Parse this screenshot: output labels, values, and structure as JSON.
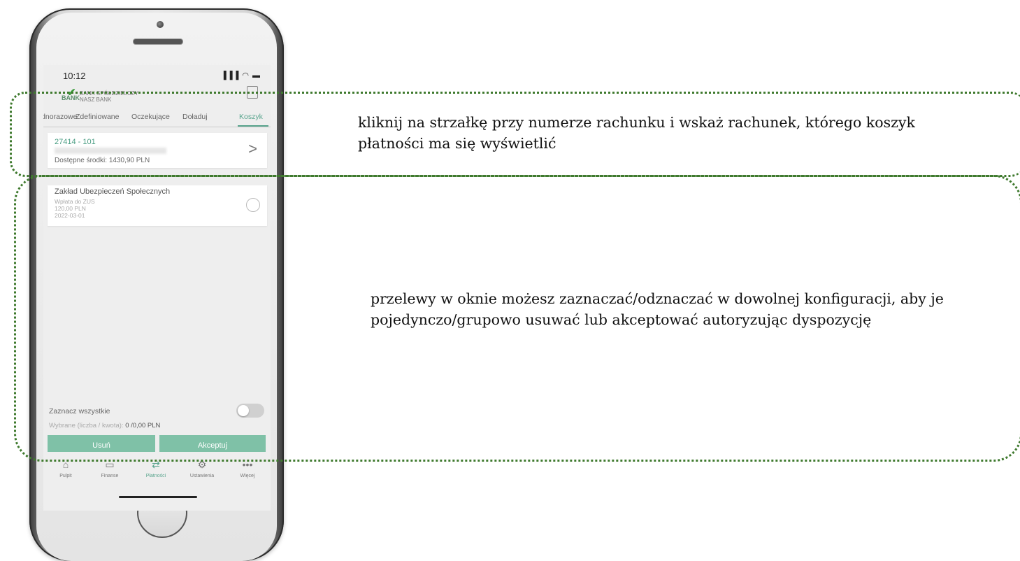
{
  "status_bar": {
    "time": "10:12",
    "icons": "▐▐▐ ◠ ▬"
  },
  "header": {
    "logo_bank": "BANK",
    "logo_name_1": "BANK SPÓŁDZIELCZY",
    "logo_name_2": "NASZ BANK"
  },
  "tabs": [
    {
      "label": "Jednorazowe",
      "active": false
    },
    {
      "label": "Zdefiniowane",
      "active": false
    },
    {
      "label": "Oczekujące",
      "active": false
    },
    {
      "label": "Doładuj",
      "active": false
    },
    {
      "label": "Koszyk",
      "active": true
    }
  ],
  "account": {
    "number": "27414 - 101",
    "balance": "Dostępne środki: 1430,90 PLN"
  },
  "payment": {
    "title": "Zakład Ubezpieczeń Społecznych",
    "type": "Wpłata do ZUS",
    "amount": "120,00 PLN",
    "date": "2022-03-01"
  },
  "select_all_label": "Zaznacz wszystkie",
  "selected_label": "Wybrane (liczba / kwota):",
  "selected_value": "0 /0,00 PLN",
  "buttons": {
    "delete": "Usuń",
    "accept": "Akceptuj"
  },
  "bottom_nav": [
    {
      "label": "Pulpit",
      "icon": "home-icon",
      "active": false
    },
    {
      "label": "Finanse",
      "icon": "wallet-icon",
      "active": false
    },
    {
      "label": "Płatności",
      "icon": "transfer-icon",
      "active": true
    },
    {
      "label": "Ustawienia",
      "icon": "gear-icon",
      "active": false
    },
    {
      "label": "Więcej",
      "icon": "more-icon",
      "active": false
    }
  ],
  "annotations": {
    "hint_1": "kliknij na strzałkę przy numerze rachunku i wskaż rachunek, którego koszyk płatności ma się wyświetlić",
    "hint_2": "przelewy w oknie możesz zaznaczać/odznaczać w dowolnej konfiguracji, aby je pojedynczo/grupowo usuwać lub akceptować autoryzując dyspozycję"
  },
  "colors": {
    "accent": "#5aa58e",
    "button": "#7fc1a7",
    "frame": "#3f7a2e"
  }
}
